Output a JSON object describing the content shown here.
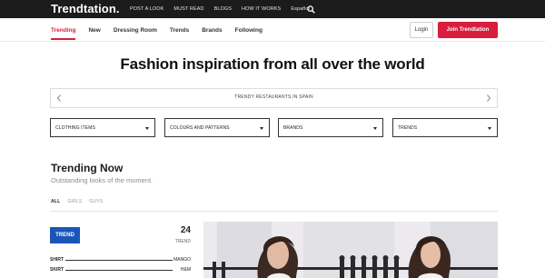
{
  "header": {
    "logo": "Trendtation.",
    "nav": [
      "POST A LOOK",
      "MUST READ",
      "BLOGS",
      "HOW IT WORKS",
      "Español"
    ],
    "search_icon": "search-icon"
  },
  "subnav": {
    "tabs": [
      "Trending",
      "New",
      "Dressing Room",
      "Trends",
      "Brands",
      "Following"
    ],
    "active_tab": "Trending",
    "login_label": "Login",
    "join_label": "Join Trendtation"
  },
  "hero": {
    "title": "Fashion inspiration from all over the world"
  },
  "carousel": {
    "label": "TRENDY RESTAURANTS IN SPAIN"
  },
  "filters": [
    "CLOTHING ITEMS",
    "COLOURS AND PATTERNS",
    "BRANDS",
    "TRENDS"
  ],
  "section": {
    "title": "Trending Now",
    "subtitle": "Outstanding looks of the moment.",
    "filter_tabs": [
      "ALL",
      "GIRLS",
      "GUYS"
    ],
    "active_filter": "ALL"
  },
  "card": {
    "badge": "TREND",
    "count": "24",
    "count_label": "TREND",
    "items": [
      {
        "item": "SHIRT",
        "brand": "MANGO"
      },
      {
        "item": "SKIRT",
        "brand": "H&M"
      }
    ]
  },
  "colors": {
    "accent": "#d81e3c",
    "badge_blue": "#1a56b8",
    "topbar": "#1b1b1b"
  }
}
